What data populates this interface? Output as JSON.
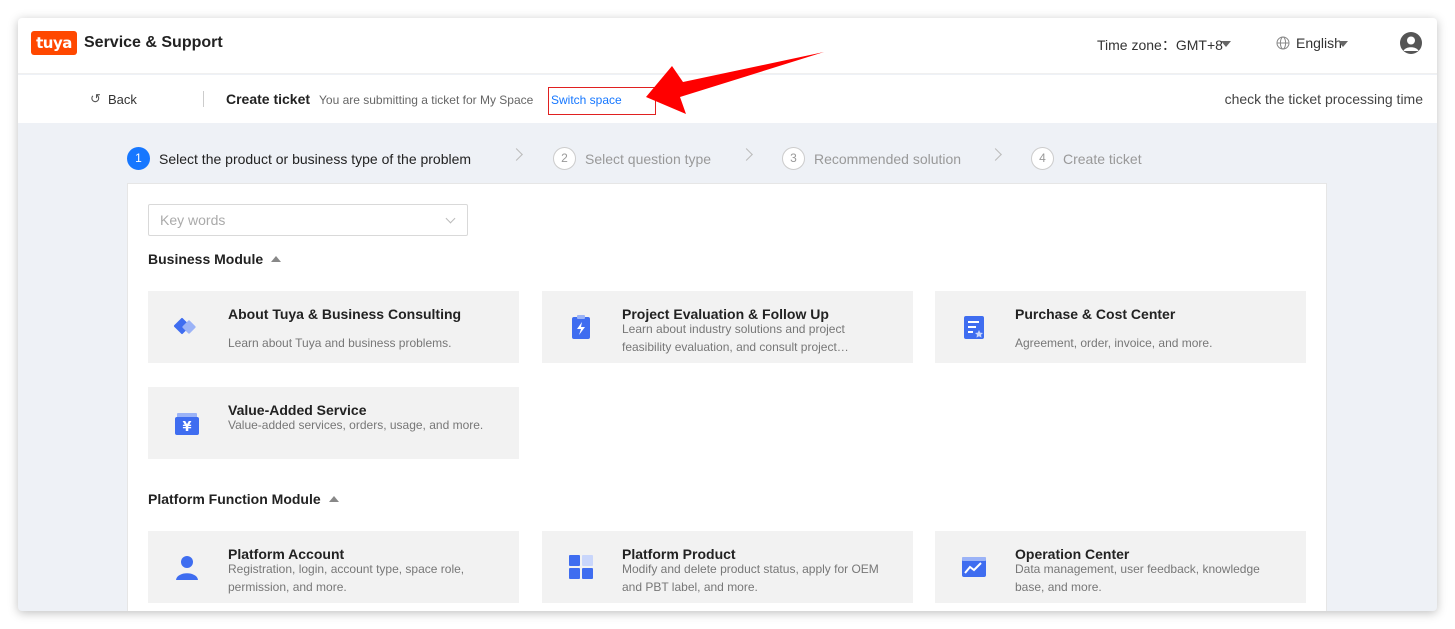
{
  "header": {
    "logo_text": "tuya",
    "brand": "Service & Support",
    "timezone_label": "Time zone：GMT+8",
    "language": "English"
  },
  "subheader": {
    "back_label": "Back",
    "title": "Create ticket",
    "info": "You are submitting a ticket for My Space",
    "switch_label": "Switch space",
    "processing_link": "check the ticket processing time"
  },
  "steps": [
    {
      "num": "1",
      "label": "Select the product or business type of the problem",
      "active": true
    },
    {
      "num": "2",
      "label": "Select question type",
      "active": false
    },
    {
      "num": "3",
      "label": "Recommended solution",
      "active": false
    },
    {
      "num": "4",
      "label": "Create ticket",
      "active": false
    }
  ],
  "search": {
    "placeholder": "Key words"
  },
  "sections": {
    "business": {
      "title": "Business Module",
      "cards": [
        {
          "title": "About Tuya & Business Consulting",
          "desc": "Learn about Tuya and business problems.",
          "icon": "handshake-icon"
        },
        {
          "title": "Project Evaluation & Follow Up",
          "desc": "Learn about industry solutions and project feasibility evaluation, and consult project…",
          "icon": "clipboard-bolt-icon"
        },
        {
          "title": "Purchase & Cost Center",
          "desc": "Agreement, order, invoice, and more.",
          "icon": "document-star-icon"
        },
        {
          "title": "Value-Added Service",
          "desc": "Value-added services, orders, usage, and more.",
          "icon": "yen-wallet-icon"
        }
      ]
    },
    "platform": {
      "title": "Platform Function Module",
      "cards": [
        {
          "title": "Platform Account",
          "desc": "Registration, login, account type, space role, permission, and more.",
          "icon": "user-icon"
        },
        {
          "title": "Platform Product",
          "desc": "Modify and delete product status, apply for OEM and PBT label, and more.",
          "icon": "blocks-icon"
        },
        {
          "title": "Operation Center",
          "desc": "Data management, user feedback, knowledge base, and more.",
          "icon": "chart-window-icon"
        }
      ]
    }
  },
  "colors": {
    "accent": "#1677ff",
    "icon_blue": "#3f6df0",
    "brand_orange": "#ff4800",
    "annotation_red": "#ff0000"
  }
}
